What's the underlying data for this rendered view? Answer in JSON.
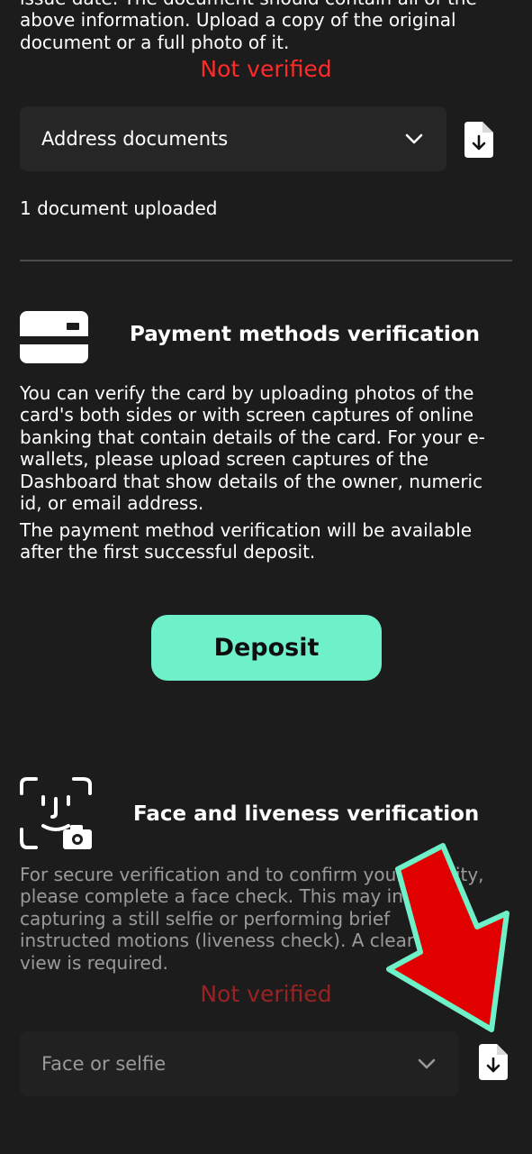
{
  "identity_section": {
    "text_lines": [
      "issue date. The document should contain all of the",
      "above information. Upload a copy of the original",
      "document or a full photo of it."
    ],
    "status": "Not verified"
  },
  "address_section": {
    "select_value": "Address documents",
    "uploaded_text": "1 document uploaded"
  },
  "payment_section": {
    "title": "Payment methods verification",
    "text_lines": [
      "You can verify the card by uploading photos of the",
      "card's both sides or with screen captures of online",
      "banking that contain details of the card. For your e-",
      "wallets, please upload screen captures of the",
      "Dashboard that show details of the owner, numeric",
      "id, or email address."
    ],
    "note_lines": [
      "The payment method verification will be available",
      "after the first successful deposit."
    ],
    "deposit_label": "Deposit"
  },
  "face_section": {
    "title": "Face and liveness verification",
    "text_lines": [
      "For secure verification and to confirm your identity,",
      "please complete a face check. This may involve",
      "capturing a still selfie or performing brief",
      "instructed motions (liveness check). A clear front",
      "view is required."
    ],
    "status": "Not verified",
    "select_value": "Face or selfie"
  },
  "colors": {
    "background": "#1c1c1c",
    "status_red": "#ff2a2a",
    "accent": "#6ef0c8",
    "arrow_red": "#e00000",
    "arrow_outline": "#6ef0c8"
  },
  "icons": {
    "file_download": "file-download-icon",
    "chevron": "chevron-down-icon",
    "card": "card-icon",
    "face_scan": "face-scan-icon",
    "annotation_arrow": "annotation-arrow"
  }
}
